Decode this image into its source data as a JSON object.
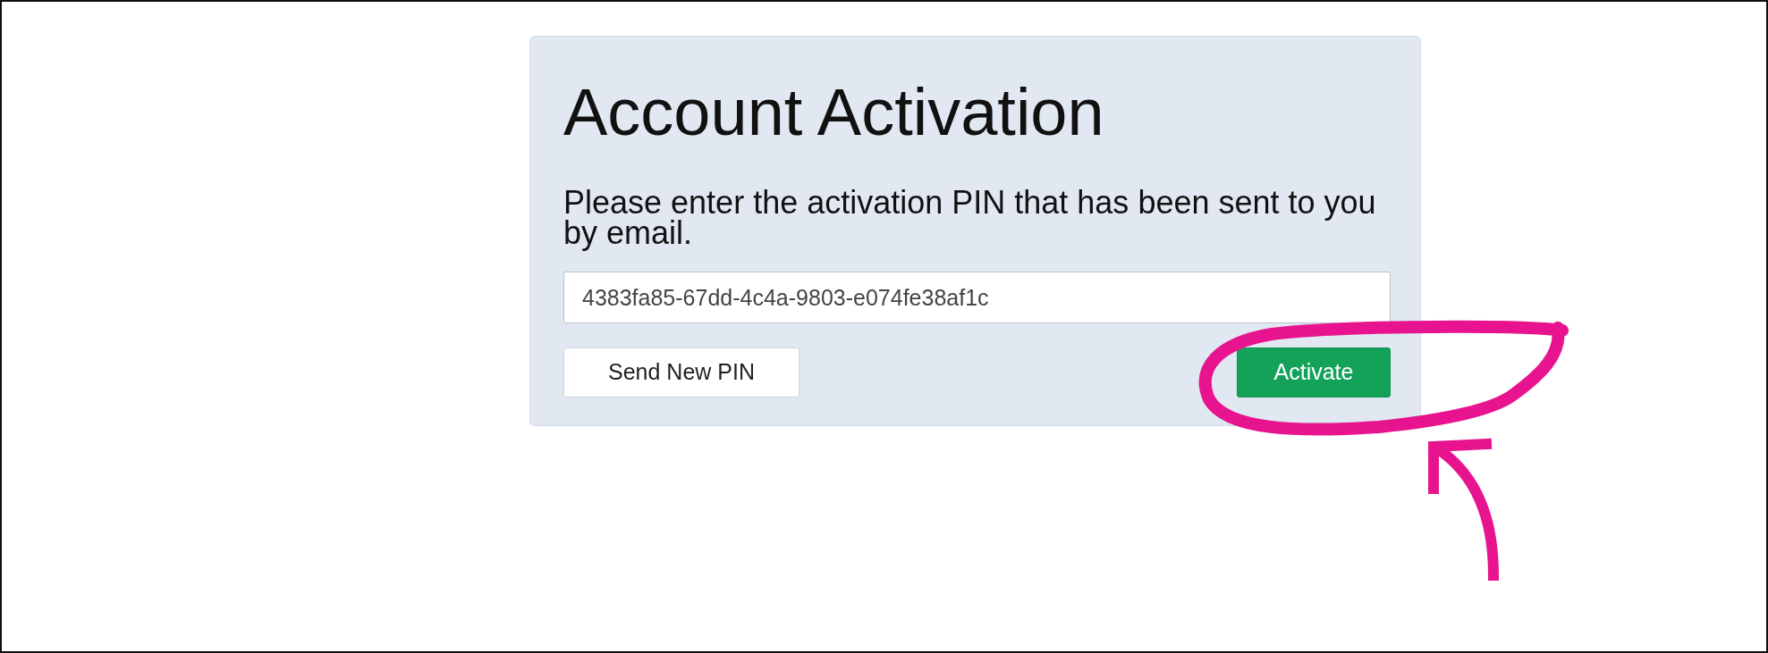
{
  "card": {
    "title": "Account Activation",
    "instructions": "Please enter the activation PIN that has been sent to you by email.",
    "pin_field": {
      "value": "4383fa85-67dd-4c4a-9803-e074fe38af1c"
    },
    "buttons": [
      {
        "label": "Send New PIN",
        "kind": "secondary"
      },
      {
        "label": "Activate",
        "kind": "primary"
      }
    ]
  }
}
